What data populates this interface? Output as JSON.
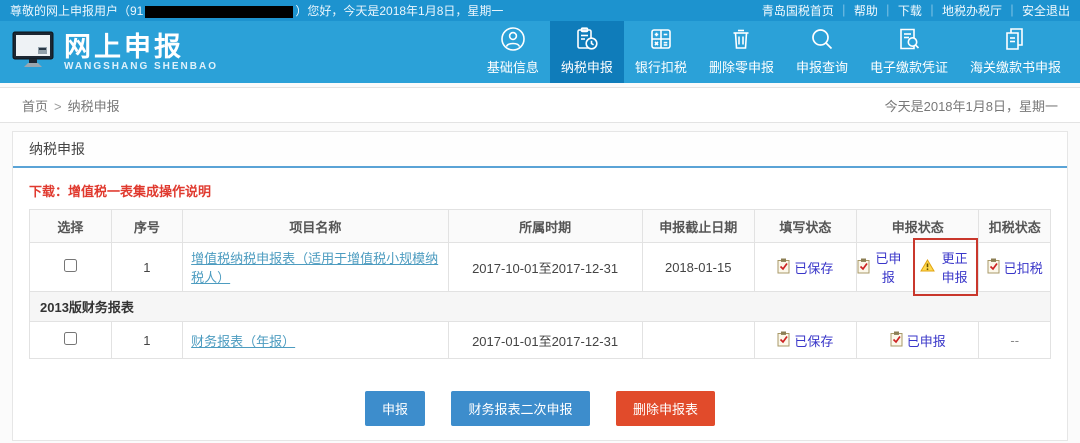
{
  "topbar": {
    "greeting_prefix": "尊敬的网上申报用户（91",
    "greeting_suffix": "）您好，今天是2018年1月8日，星期一",
    "separator": "｜",
    "links": [
      "青岛国税首页",
      "帮助",
      "下载",
      "地税办税厅",
      "安全退出"
    ]
  },
  "header": {
    "logo_title": "网上申报",
    "logo_subtitle": "WANGSHANG SHENBAO",
    "nav": [
      {
        "label": "基础信息"
      },
      {
        "label": "纳税申报",
        "active": true
      },
      {
        "label": "银行扣税"
      },
      {
        "label": "删除零申报"
      },
      {
        "label": "申报查询"
      },
      {
        "label": "电子缴款凭证"
      },
      {
        "label": "海关缴款书申报"
      }
    ]
  },
  "breadcrumb": {
    "home": "首页",
    "separator": ">",
    "current": "纳税申报",
    "today": "今天是2018年1月8日，星期一"
  },
  "section": {
    "title": "纳税申报",
    "download_link": "下载：增值税一表集成操作说明"
  },
  "table": {
    "headers": [
      "选择",
      "序号",
      "项目名称",
      "所属时期",
      "申报截止日期",
      "填写状态",
      "申报状态",
      "扣税状态"
    ],
    "group_header": "2013版财务报表",
    "rows": [
      {
        "seq": "1",
        "name": "增值税纳税申报表（适用于增值税小规模纳税人）",
        "period": "2017-10-01至2017-12-31",
        "deadline": "2018-01-15",
        "fill_status": "已保存",
        "declare_status": "已申报",
        "correction_label": "更正申报",
        "deduct_status": "已扣税"
      },
      {
        "seq": "1",
        "name": "财务报表（年报）",
        "period": "2017-01-01至2017-12-31",
        "deadline": "",
        "fill_status": "已保存",
        "declare_status": "已申报",
        "deduct_status": "--"
      }
    ]
  },
  "buttons": {
    "declare": "申报",
    "finance_second": "财务报表二次申报",
    "delete": "删除申报表"
  },
  "colors": {
    "topbar_blue": "#1d93cf",
    "header_blue": "#2ba1d8",
    "nav_active_blue": "#0f7cba",
    "name_link_teal": "#4d9cc0",
    "status_link_blue": "#3936c9",
    "download_red": "#e03a2f",
    "button_blue": "#3d8dcc",
    "delete_button_red": "#e14b2b",
    "annotation_box_red": "#c9372c",
    "warning_yellow": "#ffd94d"
  }
}
